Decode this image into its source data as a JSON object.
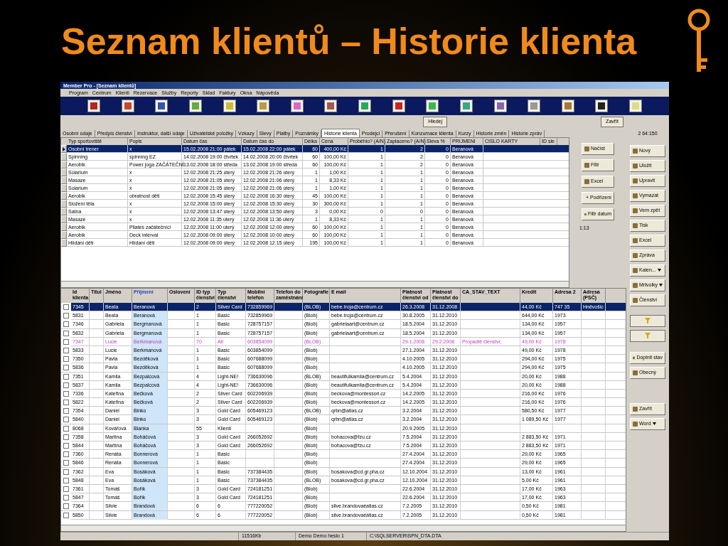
{
  "slide_title": "Seznam klientů – Historie klienta",
  "window": {
    "title": "Member Pro - [Seznam klientů]"
  },
  "menu": [
    "Program",
    "Centrum",
    "Klienti",
    "Rezervace",
    "Služby",
    "Reporty",
    "Sklad",
    "Faktury",
    "Okna",
    "Nápověda"
  ],
  "search_button": "Hledej",
  "close_button": "Zavřít",
  "tabs": [
    {
      "label": "Osobní údaje",
      "selected": false
    },
    {
      "label": "Předpis členství",
      "selected": false
    },
    {
      "label": "Instruktor, další údaje",
      "selected": false
    },
    {
      "label": "Uživatelské položky",
      "selected": false
    },
    {
      "label": "Vzkazy",
      "selected": false
    },
    {
      "label": "Slevy",
      "selected": false
    },
    {
      "label": "Platby",
      "selected": false
    },
    {
      "label": "Poznámky",
      "selected": false
    },
    {
      "label": "Historie klienta",
      "selected": true
    },
    {
      "label": "Prodejci",
      "selected": false
    },
    {
      "label": "Přerušení",
      "selected": false
    },
    {
      "label": "Konzumace klienta",
      "selected": false
    },
    {
      "label": "Kurzy",
      "selected": false
    },
    {
      "label": "Historie změn",
      "selected": false
    },
    {
      "label": "Historie zpráv",
      "selected": false
    }
  ],
  "counter": "2 64:150",
  "history": {
    "columns": [
      "Typ sportoviště",
      "Popis",
      "Datum čas",
      "Datum čas do",
      "Délka",
      "Cena",
      "Proběhlo? (A/N)",
      "Zaplaceno? (A/N)",
      "Sleva %",
      "PRIJMENI",
      "CISLO KARTY",
      "ID sle"
    ],
    "rows": [
      {
        "selected": true,
        "cells": [
          "Osobní trener",
          "x",
          "15.02.2008 21:00 pátek",
          "15.02.2008 22:00 pátek",
          "60",
          "400,00 Kč",
          "1",
          "2",
          "0",
          "Beranová"
        ]
      },
      {
        "selected": false,
        "cells": [
          "Spinning",
          "spinning EZ",
          "14.02.2008 19:00 čtvrtek",
          "14.02.2008 20:00 čtvrtek",
          "60",
          "100,00 Kč",
          "1",
          "2",
          "0",
          "Beranová"
        ]
      },
      {
        "selected": false,
        "cells": [
          "Aerobik",
          "Power joga ZAČÁTEČNÍ",
          "13.02.2008 18:00 středa",
          "13.02.2008 19:00 středa",
          "60",
          "100,00 Kč",
          "1",
          "2",
          "0",
          "Beranová"
        ]
      },
      {
        "selected": false,
        "cells": [
          "Solarium",
          "x",
          "12.02.2008 21:25 úterý",
          "12.02.2008 21:26 úterý",
          "1",
          "1,00 Kč",
          "1",
          "1",
          "0",
          "Beranová"
        ]
      },
      {
        "selected": false,
        "cells": [
          "Masaze",
          "x",
          "12.02.2008 21:05 úterý",
          "12.02.2008 21:06 úterý",
          "1",
          "8,33 Kč",
          "1",
          "1",
          "0",
          "Beranová"
        ]
      },
      {
        "selected": false,
        "cells": [
          "Solarium",
          "x",
          "12.02.2008 21:05 úterý",
          "12.02.2008 21:06 úterý",
          "1",
          "1,00 Kč",
          "1",
          "1",
          "0",
          "Beranová"
        ]
      },
      {
        "selected": false,
        "cells": [
          "Aerobik",
          "obratnost děti",
          "12.02.2008 15:45 úterý",
          "12.02.2008 16:30 úterý",
          "45",
          "100,00 Kč",
          "1",
          "1",
          "0",
          "Beranová"
        ]
      },
      {
        "selected": false,
        "cells": [
          "Složení těla",
          "x",
          "12.02.2008 15:00 úterý",
          "12.02.2008 15:30 úterý",
          "30",
          "300,00 Kč",
          "1",
          "1",
          "0",
          "Beranová"
        ]
      },
      {
        "selected": false,
        "cells": [
          "Satna",
          "x",
          "12.02.2008 13:47 úterý",
          "12.02.2008 13:50 úterý",
          "3",
          "0,00 Kč",
          "0",
          "0",
          "0",
          "Beranová"
        ]
      },
      {
        "selected": false,
        "cells": [
          "Masaze",
          "x",
          "12.02.2008 11:35 úterý",
          "12.02.2008 11:36 úterý",
          "1",
          "8,33 Kč",
          "1",
          "1",
          "0",
          "Beranová"
        ]
      },
      {
        "selected": false,
        "cells": [
          "Aerobik",
          "Pilates začátečníci",
          "12.02.2008 11:00 úterý",
          "12.02.2008 12:00 úterý",
          "60",
          "100,00 Kč",
          "1",
          "1",
          "0",
          "Beranová"
        ]
      },
      {
        "selected": false,
        "cells": [
          "Aerobik",
          "Deck interval",
          "12.02.2008 09:00 úterý",
          "12.02.2008 10:00 úterý",
          "60",
          "100,00 Kč",
          "1",
          "1",
          "0",
          "Beranová"
        ]
      },
      {
        "selected": false,
        "cells": [
          "Hlídání dětí",
          "Hlídaní dětí",
          "12.02.2008 09:00 úterý",
          "12.02.2008 12:15 úterý",
          "195",
          "100,00 Kč",
          "1",
          "1",
          "0",
          "Beranová"
        ]
      }
    ]
  },
  "panel_buttons": [
    "Načíst",
    "Filtr",
    "Excel",
    "+ Podřízení",
    "Filtr datum"
  ],
  "panel_count": "1:13",
  "clients": {
    "columns": [
      {
        "label": "Id klienta",
        "sorted": false
      },
      {
        "label": "Titul",
        "sorted": false
      },
      {
        "label": "Jméno",
        "sorted": false
      },
      {
        "label": "Příjmení",
        "sorted": true
      },
      {
        "label": "Oslovení",
        "sorted": false
      },
      {
        "label": "ID typ členství",
        "sorted": false
      },
      {
        "label": "Typ členství",
        "sorted": false
      },
      {
        "label": "Mobilní telefon",
        "sorted": false
      },
      {
        "label": "Telefon do zaměstnání",
        "sorted": false
      },
      {
        "label": "Fotografie",
        "sorted": false
      },
      {
        "label": "E mail",
        "sorted": false
      },
      {
        "label": "Platnost členství od",
        "sorted": false
      },
      {
        "label": "Platnost členství do",
        "sorted": false
      },
      {
        "label": "CA_STAV_TEXT",
        "sorted": false
      },
      {
        "label": "Kredit",
        "sorted": false
      },
      {
        "label": "Adresa 2",
        "sorted": false
      },
      {
        "label": "Adresa (PSČ)",
        "sorted": false
      }
    ],
    "rows": [
      {
        "selected": true,
        "checked": false,
        "kind": "normal",
        "id": "7345",
        "first": "Beata",
        "last": "Beranová",
        "type_id": "2",
        "type": "Silver Card",
        "mobile": "732859969",
        "photo": "(BLOB)",
        "email": "bebe.troja@centrum.cz",
        "from": "26.3.2008",
        "to": "31.12.2008",
        "credit": "44,00 Kč",
        "address2": "747 35",
        "postcode": "Hněvošic"
      },
      {
        "selected": false,
        "checked": false,
        "kind": "normal",
        "id": "5831",
        "first": "Beata",
        "last": "Beranová",
        "type_id": "1",
        "type": "Basic",
        "mobile": "732859969",
        "photo": "(Blob)",
        "email": "bebe.troja@centrum.cz",
        "from": "30.8.2005",
        "to": "31.12.2010",
        "credit": "644,00 Kč",
        "address2": "1973"
      },
      {
        "selected": false,
        "checked": false,
        "kind": "normal",
        "id": "7346",
        "first": "Gabriela",
        "last": "Bergmanová",
        "type_id": "1",
        "type": "Basic",
        "mobile": "728757157",
        "photo": "(Blob)",
        "email": "gabrielaart@centrum.cz",
        "from": "18.5.2004",
        "to": "31.12.2010",
        "credit": "134,00 Kč",
        "address2": "1957"
      },
      {
        "selected": false,
        "checked": false,
        "kind": "normal",
        "id": "5832",
        "first": "Gabriela",
        "last": "Bergmanová",
        "type_id": "1",
        "type": "Basic",
        "mobile": "728757157",
        "photo": "(Blob)",
        "email": "gabrielaart@centrum.cz",
        "from": "18.5.2004",
        "to": "31.12.2010",
        "credit": "134,00 Kč",
        "address2": "1957"
      },
      {
        "selected": false,
        "checked": false,
        "kind": "expired",
        "id": "7347",
        "first": "Lucie",
        "last": "Berkmanová",
        "type_id": "70",
        "type": "All",
        "mobile": "603854099",
        "photo": "(BLOB)",
        "from": "29.1.2008",
        "to": "29.2.2008",
        "status": "Propadlé členství;",
        "credit": "49,00 Kč",
        "address2": "1978"
      },
      {
        "selected": false,
        "checked": false,
        "kind": "normal",
        "id": "5833",
        "first": "Lucie",
        "last": "Berkmanová",
        "type_id": "1",
        "type": "Basic",
        "mobile": "603854099",
        "photo": "(Blob)",
        "from": "27.1.2004",
        "to": "31.12.2010",
        "credit": "49,00 Kč",
        "address2": "1978"
      },
      {
        "selected": false,
        "checked": false,
        "kind": "normal",
        "id": "7350",
        "first": "Pavla",
        "last": "Bezděková",
        "type_id": "1",
        "type": "Basic",
        "mobile": "607688099",
        "photo": "(Blob)",
        "from": "4.10.2005",
        "to": "31.12.2010",
        "credit": "294,00 Kč",
        "address2": "1975"
      },
      {
        "selected": false,
        "checked": false,
        "kind": "normal",
        "id": "5836",
        "first": "Pavla",
        "last": "Bezděková",
        "type_id": "1",
        "type": "Basic",
        "mobile": "607688099",
        "photo": "(Blob)",
        "from": "4.10.2005",
        "to": "31.12.2010",
        "credit": "294,00 Kč",
        "address2": "1975"
      },
      {
        "selected": false,
        "checked": false,
        "kind": "normal",
        "id": "7351",
        "first": "Kamila",
        "last": "Bezpalcová",
        "type_id": "4",
        "type": "Light-NE!",
        "mobile": "736630096",
        "photo": "(BLOB)",
        "email": "beautifulkamila@centrum.cz",
        "from": "5.4.2004",
        "to": "31.12.2010",
        "credit": "20,00 Kč",
        "address2": "1988"
      },
      {
        "selected": false,
        "checked": false,
        "kind": "normal",
        "id": "5837",
        "first": "Kamila",
        "last": "Bezpalcová",
        "type_id": "4",
        "type": "Light-NE!",
        "mobile": "736630096",
        "photo": "(Blob)",
        "email": "beautifulkamila@centrum.cz",
        "from": "5.4.2004",
        "to": "31.12.2010",
        "credit": "20,00 Kč",
        "address2": "1988"
      },
      {
        "selected": false,
        "checked": false,
        "kind": "normal",
        "id": "7336",
        "first": "Kateřina",
        "last": "Bečková",
        "type_id": "2",
        "type": "Silver Card",
        "mobile": "602206939",
        "photo": "(Blob)",
        "email": "beckova@montessori.cz",
        "from": "14.2.2005",
        "to": "31.12.2010",
        "credit": "216,00 Kč",
        "address2": "1976"
      },
      {
        "selected": false,
        "checked": false,
        "kind": "normal",
        "id": "5822",
        "first": "Kateřina",
        "last": "Bečková",
        "type_id": "2",
        "type": "Silver Card",
        "mobile": "602206939",
        "photo": "(Blob)",
        "email": "beckova@montessori.cz",
        "from": "14.2.2005",
        "to": "31.12.2010",
        "credit": "216,00 Kč",
        "address2": "1976"
      },
      {
        "selected": false,
        "checked": false,
        "kind": "normal",
        "id": "7354",
        "first": "Daniel",
        "last": "Binko",
        "type_id": "3",
        "type": "Gold Card",
        "mobile": "605469123",
        "photo": "(BLOB)",
        "email": "qrbn@atlas.cz",
        "from": "3.2.2004",
        "to": "31.12.2010",
        "credit": "580,50 Kč",
        "address2": "1977"
      },
      {
        "selected": false,
        "checked": false,
        "kind": "normal",
        "id": "5840",
        "first": "Daniel",
        "last": "Binko",
        "type_id": "3",
        "type": "Gold Card",
        "mobile": "605469123",
        "photo": "(Blob)",
        "email": "qrbn@atlas.cz",
        "from": "3.2.2004",
        "to": "31.12.2010",
        "credit": "1 089,50 Kč",
        "address2": "1977"
      },
      {
        "selected": false,
        "checked": false,
        "kind": "normal",
        "id": "8068",
        "first": "Kovářová",
        "last": "Blanka",
        "type_id": "55",
        "type": "Klienti",
        "photo": "(Blob)",
        "from": "20.9.2005",
        "to": "31.12.2010"
      },
      {
        "selected": false,
        "checked": false,
        "kind": "normal",
        "id": "7358",
        "first": "Martina",
        "last": "Boháčová",
        "type_id": "3",
        "type": "Gold Card",
        "mobile": "266052692",
        "photo": "(Blob)",
        "email": "bohacova@fzu.cz",
        "from": "7.5.2004",
        "to": "31.12.2010",
        "credit": "2 883,50 Kč",
        "address2": "1971"
      },
      {
        "selected": false,
        "checked": false,
        "kind": "normal",
        "id": "5844",
        "first": "Martina",
        "last": "Boháčová",
        "type_id": "3",
        "type": "Gold Card",
        "mobile": "266052692",
        "photo": "(Blob)",
        "email": "bohacova@fzu.cz",
        "from": "7.5.2004",
        "to": "31.12.2010",
        "credit": "2 883,50 Kč",
        "address2": "1971"
      },
      {
        "selected": false,
        "checked": false,
        "kind": "normal",
        "id": "7360",
        "first": "Renáta",
        "last": "Bonnerová",
        "type_id": "1",
        "type": "Basic",
        "photo": "(Blob)",
        "from": "27.4.2004",
        "to": "31.12.2010",
        "credit": "29,00 Kč",
        "address2": "1965"
      },
      {
        "selected": false,
        "checked": false,
        "kind": "normal",
        "id": "5846",
        "first": "Renáta",
        "last": "Bonnerová",
        "type_id": "1",
        "type": "Basic",
        "photo": "(Blob)",
        "from": "27.4.2004",
        "to": "31.12.2010",
        "credit": "29,00 Kč",
        "address2": "1965"
      },
      {
        "selected": false,
        "checked": false,
        "kind": "normal",
        "id": "7362",
        "first": "Eva",
        "last": "Bosáková",
        "type_id": "1",
        "type": "Basic",
        "mobile": "737384435",
        "photo": "(Blob)",
        "email": "bosakova@cd.gr.pha.cz",
        "from": "12.10.2004",
        "to": "31.12.2010",
        "credit": "13,00 Kč",
        "address2": "1961"
      },
      {
        "selected": false,
        "checked": false,
        "kind": "normal",
        "id": "5848",
        "first": "Eva",
        "last": "Bosáková",
        "type_id": "1",
        "type": "Basic",
        "mobile": "737384435",
        "photo": "(BLOB)",
        "email": "bosakova@cd.gr.pha.cz",
        "from": "12.10.2004",
        "to": "31.12.2010",
        "credit": "5,00 Kč",
        "address2": "1961"
      },
      {
        "selected": false,
        "checked": false,
        "kind": "normal",
        "id": "7361",
        "first": "Tomáš",
        "last": "Bořík",
        "type_id": "3",
        "type": "Gold Card",
        "mobile": "724181251",
        "photo": "(Blob)",
        "from": "22.6.2004",
        "to": "31.12.2010",
        "credit": "17,00 Kč",
        "address2": "1963"
      },
      {
        "selected": false,
        "checked": false,
        "kind": "normal",
        "id": "5847",
        "first": "Tomáš",
        "last": "Bořík",
        "type_id": "3",
        "type": "Gold Card",
        "mobile": "724181251",
        "photo": "(Blob)",
        "from": "22.6.2004",
        "to": "31.12.2010",
        "credit": "17,00 Kč",
        "address2": "1963"
      },
      {
        "selected": false,
        "checked": false,
        "kind": "normal",
        "id": "7364",
        "first": "Silvie",
        "last": "Brandová",
        "type_id": "6",
        "type": "6",
        "mobile": "777220052",
        "photo": "(Blob)",
        "email": "silve.brandovaéatlas.cz",
        "from": "7.2.2005",
        "to": "31.12.2010",
        "credit": "0,50 Kč",
        "address2": "1981"
      },
      {
        "selected": false,
        "checked": false,
        "kind": "normal",
        "id": "5850",
        "first": "Silvie",
        "last": "Brandová",
        "type_id": "6",
        "type": "6",
        "mobile": "777220052",
        "photo": "(Blob)",
        "email": "silve.brandovaéatlas.cz",
        "from": "7.2.2005",
        "to": "31.12.2010",
        "credit": "0,50 Kč",
        "address2": "1981"
      }
    ]
  },
  "side_buttons": [
    {
      "kind": "button",
      "label": "Nový"
    },
    {
      "kind": "button",
      "label": "Uložit"
    },
    {
      "kind": "button",
      "label": "Upravit"
    },
    {
      "kind": "button",
      "label": "Vymazat"
    },
    {
      "kind": "button",
      "label": "Vem zpět"
    },
    {
      "kind": "button",
      "label": "Tisk"
    },
    {
      "kind": "button",
      "label": "Excel"
    },
    {
      "kind": "button",
      "label": "Zpráva"
    },
    {
      "kind": "menu",
      "label": "Kalen..."
    },
    {
      "kind": "menu",
      "label": "Mrtvolky"
    },
    {
      "kind": "button",
      "label": "Členství"
    }
  ],
  "lower_buttons": [
    {
      "kind": "button",
      "label": "Doplnit stav"
    },
    {
      "kind": "button",
      "label": "Obecný"
    },
    {
      "kind": "button",
      "label": "Zavřít"
    },
    {
      "kind": "menu",
      "label": "Word"
    }
  ],
  "status_bar": [
    "11516Kb",
    "Demo Demo heslo 1",
    "C:\\SQLSERVER\\SPN_DTA.DTA"
  ]
}
